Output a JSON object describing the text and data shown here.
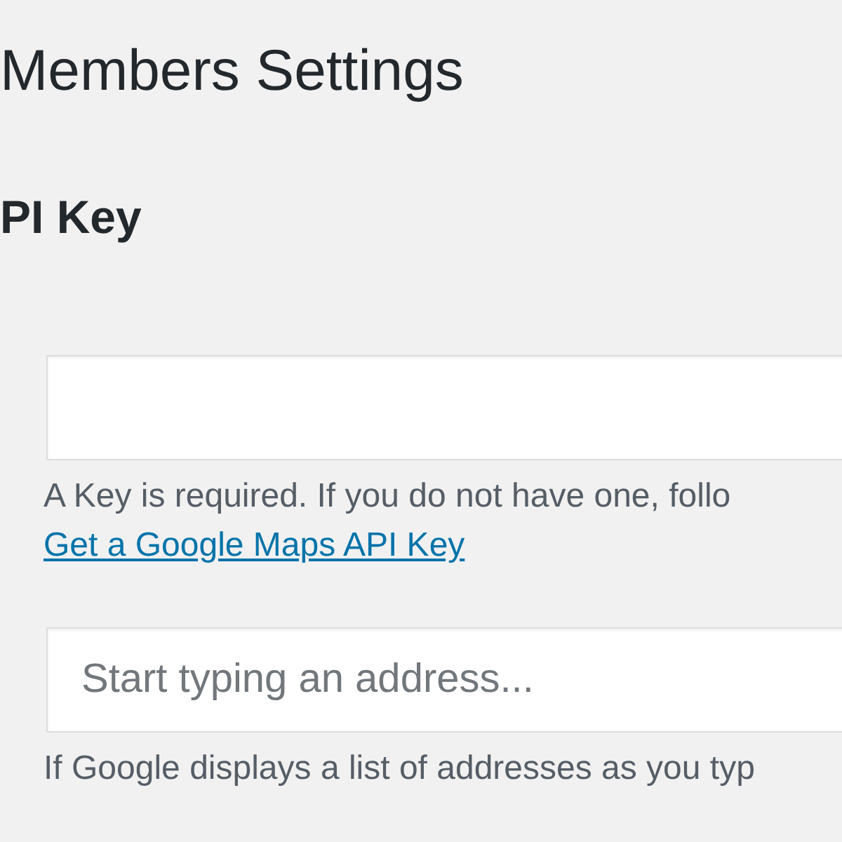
{
  "page_title": "Members Settings",
  "section_heading": "PI Key",
  "api_key_help": "A Key is required. If you do not have one, follo",
  "api_key_link": "Get a Google Maps API Key",
  "address_field": {
    "placeholder": "Start typing an address..."
  },
  "address_help": "If Google displays a list of addresses as you typ"
}
